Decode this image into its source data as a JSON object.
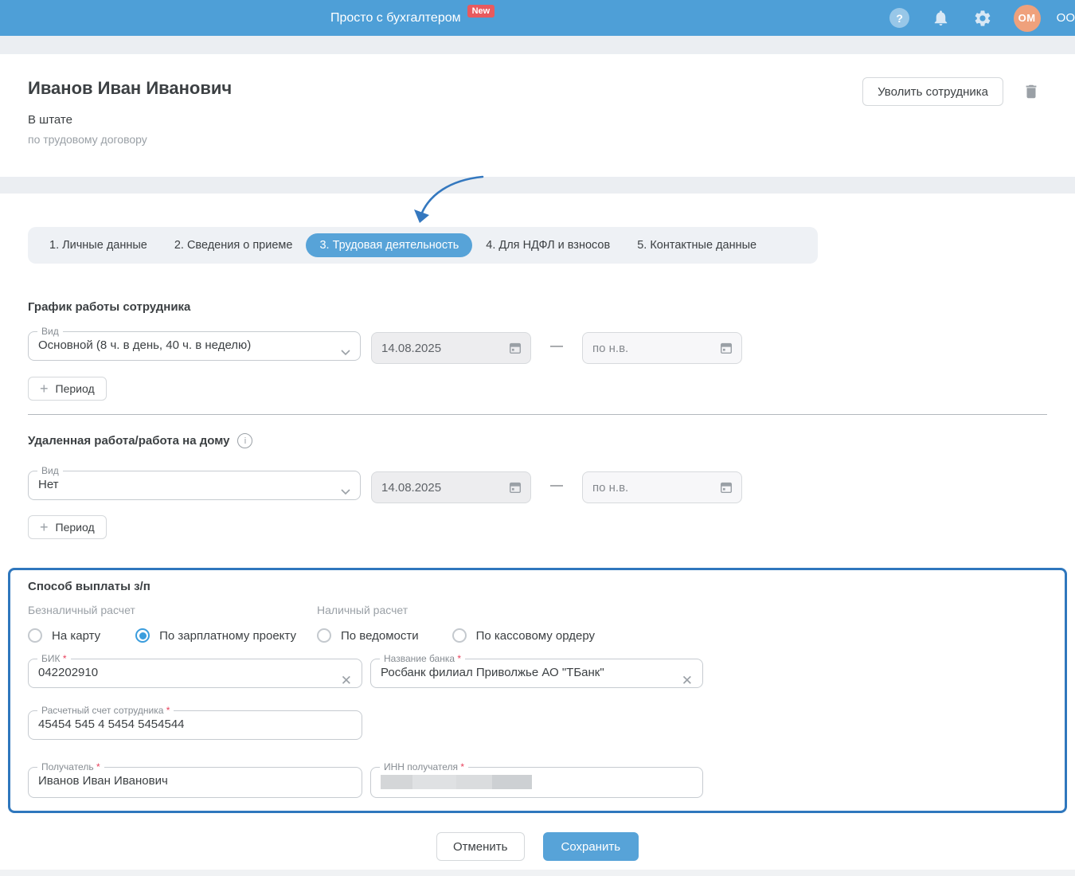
{
  "colors": {
    "topbar_blue": "#4e9fd7",
    "accent_blue": "#57a3d8",
    "highlight_border_blue": "#2f77bd",
    "badge_red": "#e85a5e",
    "avatar_orange": "#efa17c",
    "required_mark_red": "#e8415c"
  },
  "topbar": {
    "title": "Просто с бухгалтером",
    "badge": "New",
    "avatar_initials": "OM",
    "org_label": "ОО"
  },
  "header": {
    "employee_name": "Иванов Иван Иванович",
    "status": "В штате",
    "substatus": "по трудовому договору",
    "dismiss_button": "Уволить сотрудника"
  },
  "tabs": [
    {
      "label": "1. Личные данные",
      "active": false
    },
    {
      "label": "2. Сведения о приеме",
      "active": false
    },
    {
      "label": "3. Трудовая деятельность",
      "active": true
    },
    {
      "label": "4. Для НДФЛ и взносов",
      "active": false
    },
    {
      "label": "5. Контактные данные",
      "active": false
    }
  ],
  "schedule": {
    "title": "График работы сотрудника",
    "type_label": "Вид",
    "type_value": "Основной (8 ч. в день, 40 ч. в неделю)",
    "date_from": "14.08.2025",
    "date_separator": "—",
    "date_to": "по н.в.",
    "add_period_button": "Период"
  },
  "remote": {
    "title": "Удаленная работа/работа на дому",
    "type_label": "Вид",
    "type_value": "Нет",
    "date_from": "14.08.2025",
    "date_separator": "—",
    "date_to": "по н.в.",
    "add_period_button": "Период"
  },
  "payment": {
    "title": "Способ выплаты з/п",
    "cashless_group_label": "Безналичный расчет",
    "cash_group_label": "Наличный расчет",
    "radios": [
      {
        "label": "На карту",
        "selected": false
      },
      {
        "label": "По зарплатному проекту",
        "selected": true
      },
      {
        "label": "По ведомости",
        "selected": false
      },
      {
        "label": "По кассовому ордеру",
        "selected": false
      }
    ],
    "bik": {
      "label": "БИК",
      "required_mark": "*",
      "value": "042202910"
    },
    "bank_name": {
      "label": "Название банка",
      "required_mark": "*",
      "value": "Росбанк филиал Приволжье АО \"ТБанк\""
    },
    "account": {
      "label": "Расчетный счет сотрудника",
      "required_mark": "*",
      "value": "45454 545 4 5454 5454544"
    },
    "recipient": {
      "label": "Получатель",
      "required_mark": "*",
      "value": "Иванов Иван Иванович"
    },
    "recipient_inn": {
      "label": "ИНН получателя",
      "required_mark": "*",
      "value_redacted": true
    }
  },
  "footer": {
    "cancel_button": "Отменить",
    "save_button": "Сохранить"
  }
}
